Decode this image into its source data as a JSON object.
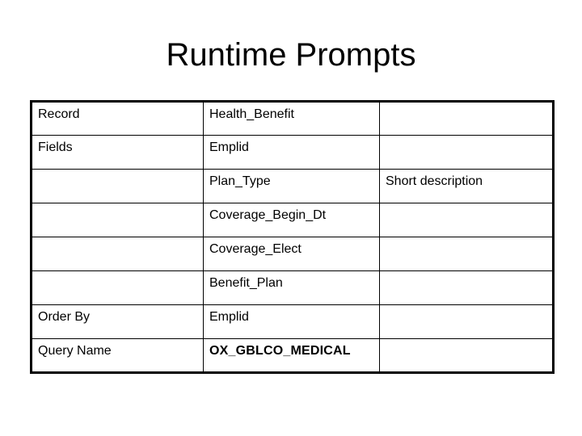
{
  "slide": {
    "title": "Runtime Prompts",
    "background_color": "#ffffff",
    "text_color": "#000000"
  },
  "table": {
    "columns": 3,
    "rows": 8,
    "border_color": "#000000",
    "cells": [
      {
        "label": "Record",
        "field": "Health_Benefit",
        "note": ""
      },
      {
        "label": "Fields",
        "field": "Emplid",
        "note": ""
      },
      {
        "label": "",
        "field": "Plan_Type",
        "note": "Short description"
      },
      {
        "label": "",
        "field": "Coverage_Begin_Dt",
        "note": ""
      },
      {
        "label": "",
        "field": "Coverage_Elect",
        "note": ""
      },
      {
        "label": "",
        "field": "Benefit_Plan",
        "note": ""
      },
      {
        "label": "Order By",
        "field": "Emplid",
        "note": ""
      },
      {
        "label": "Query Name",
        "field": "OX_GBLCO_MEDICAL",
        "note": ""
      }
    ]
  }
}
